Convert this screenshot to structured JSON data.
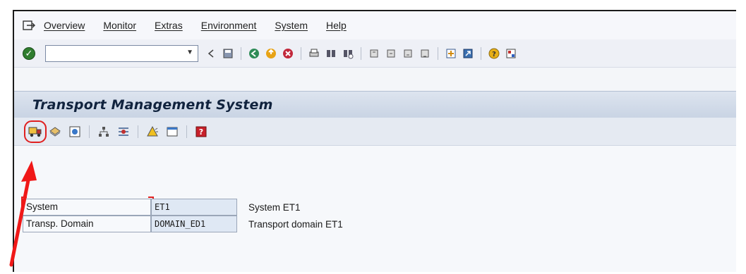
{
  "menu": {
    "items": [
      "Overview",
      "Monitor",
      "Extras",
      "Environment",
      "System",
      "Help"
    ]
  },
  "toolbar": {
    "command_value": ""
  },
  "title": "Transport Management System",
  "form": {
    "rows": [
      {
        "label": "System",
        "value": "ET1",
        "description": "System ET1"
      },
      {
        "label": "Transp. Domain",
        "value": "DOMAIN_ED1",
        "description": "Transport domain ET1"
      }
    ]
  },
  "colors": {
    "accent": "#e02020",
    "title_bar": "#c9d4e4"
  }
}
